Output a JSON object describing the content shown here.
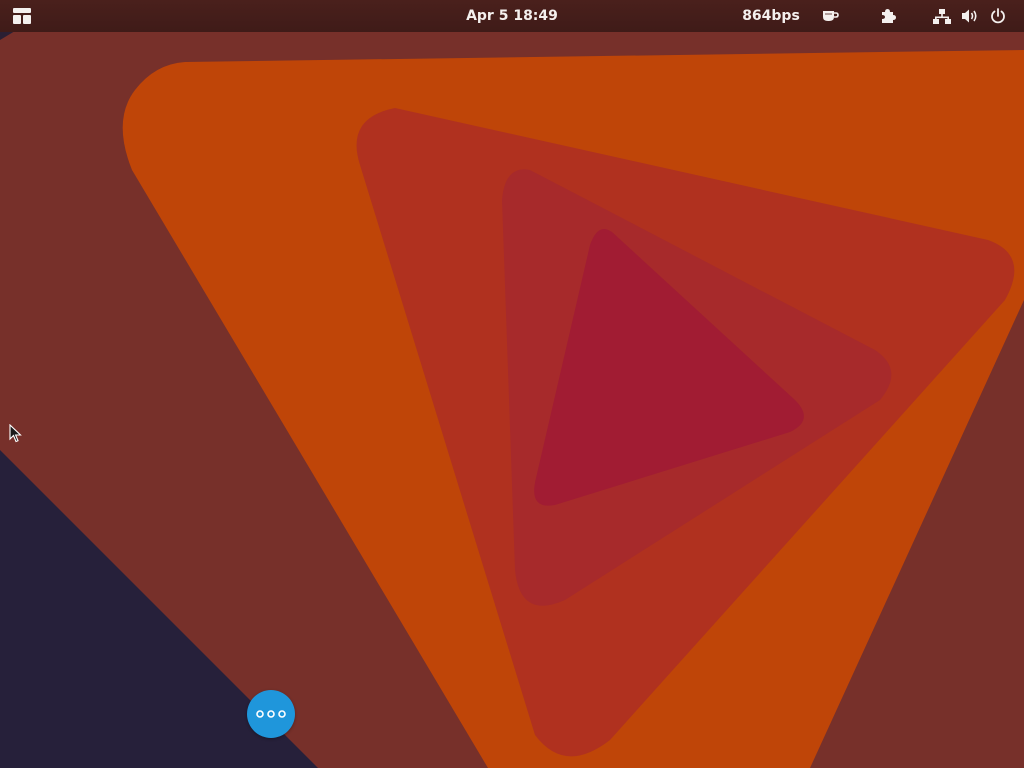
{
  "topbar": {
    "activities_icon": "activities-grid-icon",
    "clock": "Apr 5  18:49",
    "network_speed": "864bps",
    "icons": {
      "caffeine": "coffee-cup-icon",
      "extensions": "puzzle-piece-icon",
      "network": "wired-network-icon",
      "volume": "speaker-volume-icon",
      "power": "power-icon"
    }
  },
  "desktop": {
    "fab_icon": "more-dots-icon",
    "colors": {
      "background": "#77302a",
      "dark_corner": "#26203a",
      "orange": "#bf4508",
      "red_outer": "#b0311f",
      "red_mid": "#a72a2b",
      "red_inner": "#a11c33",
      "fab": "#1f96db"
    }
  }
}
